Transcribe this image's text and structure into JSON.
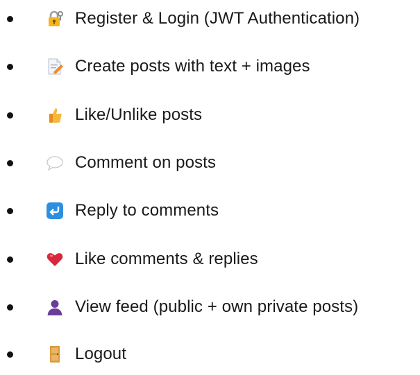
{
  "features": {
    "items": [
      {
        "icon": "lock-with-key-icon",
        "label": "Register & Login (JWT Authentication)"
      },
      {
        "icon": "memo-pencil-icon",
        "label": "Create posts with text + images"
      },
      {
        "icon": "thumbs-up-icon",
        "label": "Like/Unlike posts"
      },
      {
        "icon": "speech-bubble-icon",
        "label": "Comment on posts"
      },
      {
        "icon": "reply-arrow-icon",
        "label": "Reply to comments"
      },
      {
        "icon": "red-heart-icon",
        "label": "Like comments & replies"
      },
      {
        "icon": "user-silhouette-icon",
        "label": "View feed (public + own private posts)"
      },
      {
        "icon": "door-icon",
        "label": "Logout"
      }
    ]
  },
  "colors": {
    "text": "#1a1a1a",
    "bullet": "#111111",
    "lock": "#f2b51d",
    "thumb": "#f6b73c",
    "reply": "#2d8fe0",
    "heart": "#d9283b",
    "user": "#6a3d9a",
    "door": "#d99a3c"
  }
}
